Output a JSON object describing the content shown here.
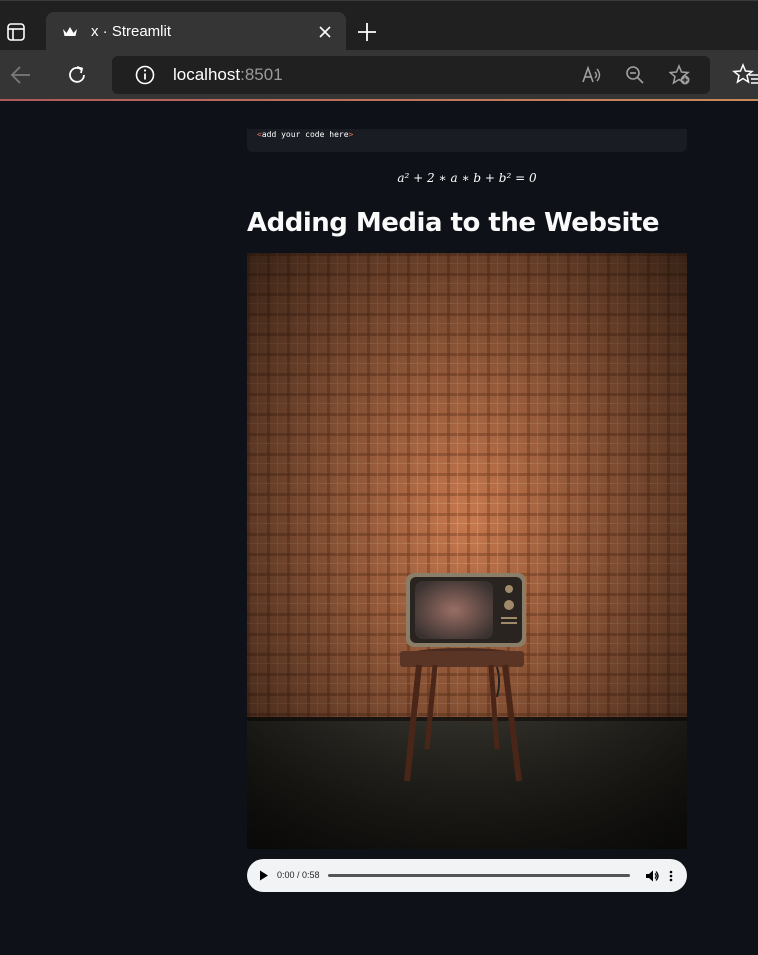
{
  "browser": {
    "tab_title": "x · Streamlit",
    "url_host": "localhost",
    "url_port": ":8501"
  },
  "code_block": {
    "tag_open": "<",
    "text": "add your code here",
    "tag_close": ">"
  },
  "latex": "a² + 2 ∗ a ∗ b + b² = 0",
  "heading": "Adding Media to the Website",
  "audio": {
    "time": "0:00 / 0:58",
    "progress": 0
  },
  "colors": {
    "background": "#0e1117",
    "heading": "#fafafa",
    "wallpaper": "#c8794e",
    "floor": "#3d3b33"
  }
}
